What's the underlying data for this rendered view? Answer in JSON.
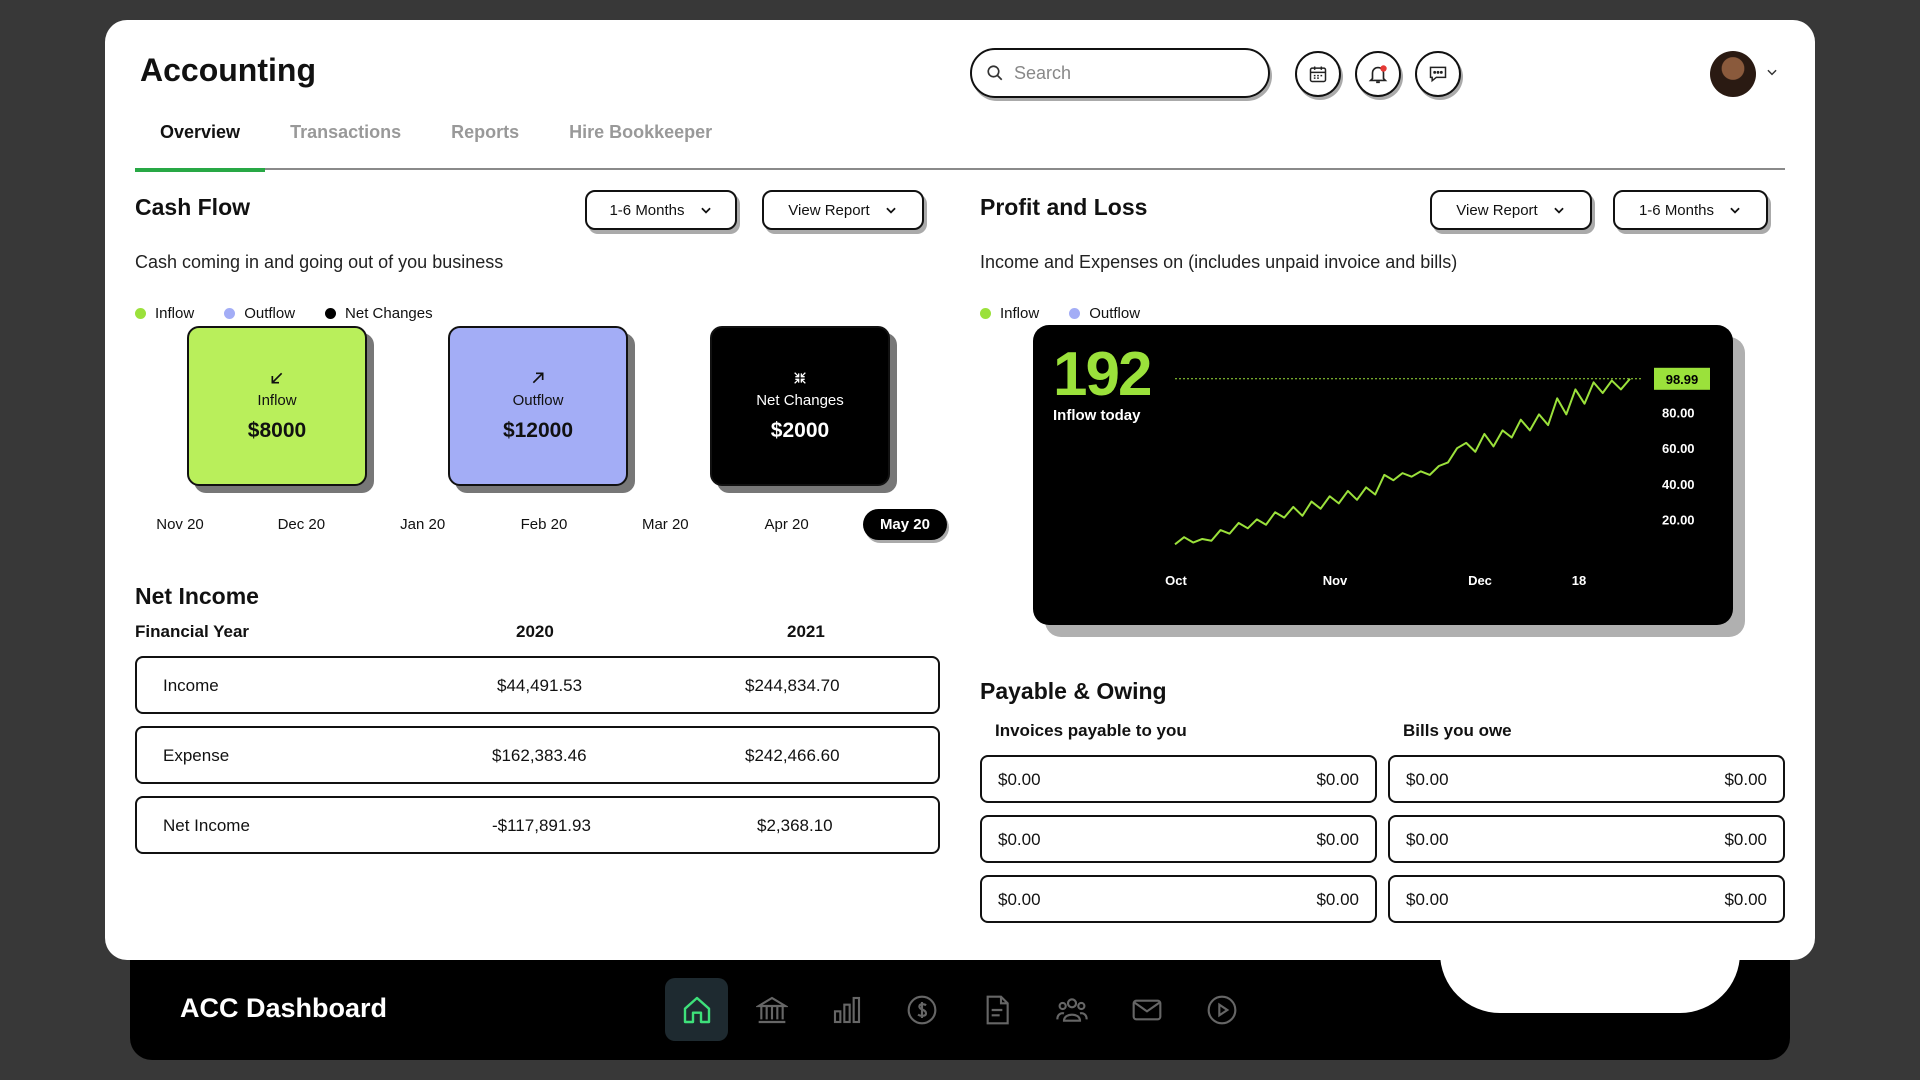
{
  "app": {
    "title": "Accounting"
  },
  "tabs": [
    {
      "label": "Overview",
      "active": true
    },
    {
      "label": "Transactions",
      "active": false
    },
    {
      "label": "Reports",
      "active": false
    },
    {
      "label": "Hire Bookkeeper",
      "active": false
    }
  ],
  "search": {
    "placeholder": "Search",
    "value": ""
  },
  "header_icons": [
    "calendar-icon",
    "notification-bell-icon",
    "chat-icon"
  ],
  "colors": {
    "inflow": "#9be13b",
    "outflow": "#a3adf6",
    "net": "#000000",
    "accent_tab": "#28a845"
  },
  "cash_flow": {
    "title": "Cash Flow",
    "range_dropdown": "1-6 Months",
    "report_dropdown": "View Report",
    "subtitle": "Cash coming in and going out of you business",
    "legend": [
      "Inflow",
      "Outflow",
      "Net Changes"
    ],
    "cards": [
      {
        "label": "Inflow",
        "value": "$8000",
        "icon": "arrow-down-left-icon"
      },
      {
        "label": "Outflow",
        "value": "$12000",
        "icon": "arrow-up-right-icon"
      },
      {
        "label": "Net Changes",
        "value": "$2000",
        "icon": "collapse-icon"
      }
    ],
    "months": [
      "Nov 20",
      "Dec 20",
      "Jan 20",
      "Feb 20",
      "Mar 20",
      "Apr 20",
      "May 20"
    ],
    "selected_month": "May 20"
  },
  "net_income": {
    "title": "Net Income",
    "headers": [
      "Financial Year",
      "2020",
      "2021"
    ],
    "rows": [
      {
        "label": "Income",
        "y2020": "$44,491.53",
        "y2021": "$244,834.70"
      },
      {
        "label": "Expense",
        "y2020": "$162,383.46",
        "y2021": "$242,466.60"
      },
      {
        "label": "Net Income",
        "y2020": "-$117,891.93",
        "y2021": "$2,368.10"
      }
    ]
  },
  "profit_loss": {
    "title": "Profit and Loss",
    "report_dropdown": "View Report",
    "range_dropdown": "1-6 Months",
    "subtitle": "Income and Expenses on (includes unpaid invoice and bills)",
    "legend": [
      "Inflow",
      "Outflow"
    ],
    "big_number": "192",
    "big_label": "Inflow today",
    "current_value_label": "98.99"
  },
  "chart_data": {
    "type": "line",
    "x_tick_labels": [
      "Oct",
      "Nov",
      "Dec",
      "18"
    ],
    "y_tick_labels": [
      "80.00",
      "60.00",
      "40.00",
      "20.00"
    ],
    "ylim": [
      0,
      100
    ],
    "current_value": 98.99,
    "series": [
      {
        "values": [
          6,
          10,
          7,
          9,
          8,
          14,
          12,
          18,
          15,
          20,
          17,
          24,
          21,
          27,
          22,
          30,
          26,
          33,
          29,
          36,
          31,
          38,
          34,
          45,
          42,
          46,
          44,
          47,
          45,
          50,
          52,
          60,
          63,
          58,
          68,
          61,
          70,
          66,
          76,
          70,
          79,
          73,
          88,
          79,
          93,
          85,
          97,
          91,
          98,
          93,
          99
        ]
      }
    ]
  },
  "payable": {
    "title": "Payable & Owing",
    "invoices_header": "Invoices payable to you",
    "bills_header": "Bills you owe",
    "invoices": [
      {
        "left": "$0.00",
        "right": "$0.00"
      },
      {
        "left": "$0.00",
        "right": "$0.00"
      },
      {
        "left": "$0.00",
        "right": "$0.00"
      }
    ],
    "bills": [
      {
        "left": "$0.00",
        "right": "$0.00"
      },
      {
        "left": "$0.00",
        "right": "$0.00"
      },
      {
        "left": "$0.00",
        "right": "$0.00"
      }
    ]
  },
  "dock": {
    "title": "ACC Dashboard",
    "icons": [
      "home-icon",
      "bank-icon",
      "bar-chart-icon",
      "dollar-icon",
      "document-icon",
      "team-icon",
      "mail-icon",
      "play-icon"
    ],
    "active": "home-icon"
  }
}
